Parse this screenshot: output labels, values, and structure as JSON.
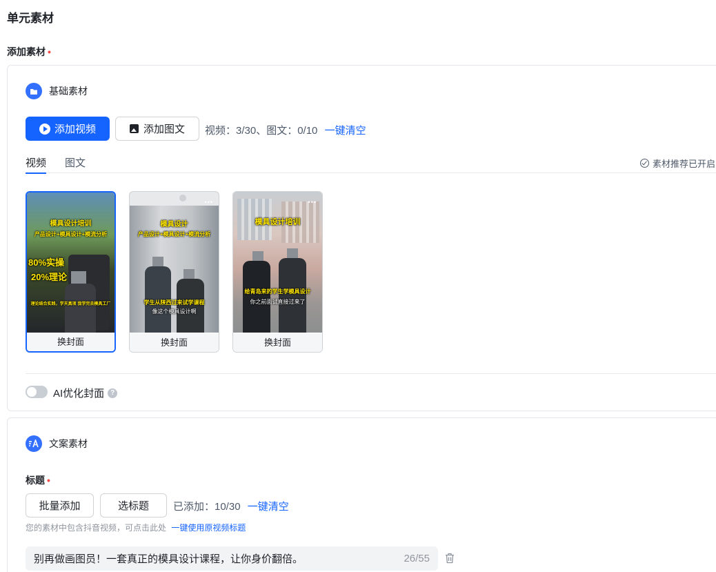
{
  "page": {
    "title": "单元素材",
    "add_material_label": "添加素材",
    "required_mark": "•"
  },
  "basic": {
    "title": "基础素材",
    "add_video_label": "添加视频",
    "add_image_label": "添加图文",
    "count_text": "视频：3/30、图文：0/10",
    "clear_label": "一键清空",
    "tabs": [
      {
        "label": "视频",
        "active": true
      },
      {
        "label": "图文",
        "active": false
      }
    ],
    "recommend_text": "素材推荐已开启",
    "videos": [
      {
        "cover_label": "换封面",
        "selected": true,
        "caption_title": "模具设计培训",
        "caption_sub": "产品设计+模具设计+模流分析",
        "tag_1": "80%实操",
        "tag_2": "20%理论",
        "caption_bottom": "理论结合实践，学天真项 我学完去模具工厂"
      },
      {
        "cover_label": "换封面",
        "selected": false,
        "caption_title": "模具设计",
        "caption_sub": "产品设计+模具设计+模流分析",
        "caption_bottom": "学生从陕西过来试学课程",
        "caption_bottom_2": "像这个模具设计啊"
      },
      {
        "cover_label": "换封面",
        "selected": false,
        "caption_title": "模具设计培训",
        "caption_bottom": "给青岛来的学生学模具设计",
        "caption_bottom_2": "你之前面试直接过来了"
      }
    ],
    "ai_cover_label": "AI优化封面",
    "ai_cover_enabled": false
  },
  "copy": {
    "title": "文案素材",
    "title_field_label": "标题",
    "batch_add_label": "批量添加",
    "pick_title_label": "选标题",
    "added_count": "已添加：10/30",
    "clear_label": "一键清空",
    "hint_text": "您的素材中包含抖音视频，可点击此处",
    "hint_link": "一键使用原视频标题",
    "titles": [
      {
        "text": "别再做画图员！一套真正的模具设计课程，让你身价翻倍。",
        "length": "26/55"
      }
    ]
  },
  "colors": {
    "primary": "#1664ff",
    "required": "#f54a45",
    "caption_yellow": "#ffe600"
  }
}
